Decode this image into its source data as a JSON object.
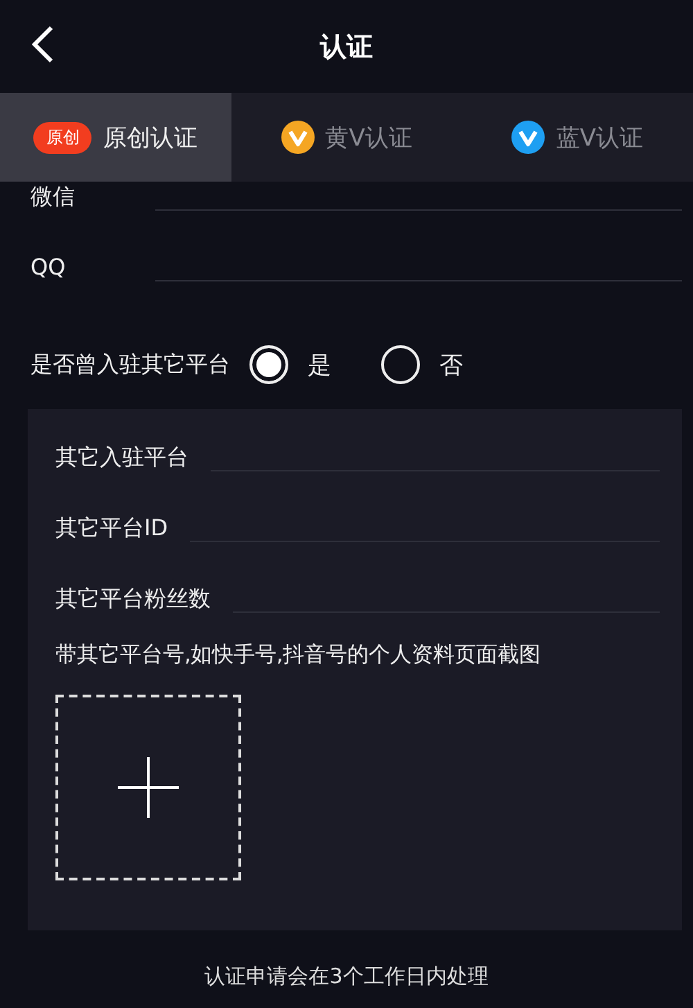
{
  "header": {
    "title": "认证"
  },
  "tabs": [
    {
      "label": "原创认证",
      "kind": "badge",
      "badge": "原创",
      "selected": true
    },
    {
      "label": "黄V认证",
      "kind": "v-icon",
      "color": "#f5a623",
      "selected": false
    },
    {
      "label": "蓝V认证",
      "kind": "v-icon",
      "color": "#1e9ff2",
      "selected": false
    }
  ],
  "contact_fields": [
    {
      "label": "微信"
    },
    {
      "label": "QQ"
    }
  ],
  "other_platform": {
    "question": "是否曾入驻其它平台",
    "options": [
      {
        "label": "是",
        "selected": true
      },
      {
        "label": "否",
        "selected": false
      }
    ]
  },
  "platform_fields": [
    {
      "label": "其它入驻平台"
    },
    {
      "label": "其它平台ID"
    },
    {
      "label": "其它平台粉丝数"
    }
  ],
  "screenshot_hint": "带其它平台号,如快手号,抖音号的个人资料页面截图",
  "footer_note": "认证申请会在3个工作日内处理"
}
